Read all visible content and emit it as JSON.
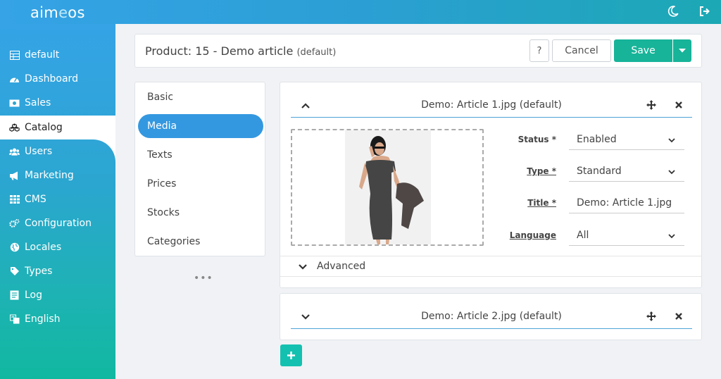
{
  "app": {
    "logo_left": "aim",
    "logo_o": "e",
    "logo_right": "os"
  },
  "sidebar": {
    "items": [
      {
        "label": "default",
        "icon": "table-icon"
      },
      {
        "label": "Dashboard",
        "icon": "dashboard-icon"
      },
      {
        "label": "Sales",
        "icon": "money-icon"
      },
      {
        "label": "Catalog",
        "icon": "cubes-icon",
        "active": true
      },
      {
        "label": "Users",
        "icon": "users-icon"
      },
      {
        "label": "Marketing",
        "icon": "bullhorn-icon"
      },
      {
        "label": "CMS",
        "icon": "grid-icon"
      },
      {
        "label": "Configuration",
        "icon": "cogs-icon"
      },
      {
        "label": "Locales",
        "icon": "globe-icon"
      },
      {
        "label": "Types",
        "icon": "tag-icon"
      },
      {
        "label": "Log",
        "icon": "file-icon"
      },
      {
        "label": "English",
        "icon": "language-icon"
      }
    ]
  },
  "header": {
    "title": "Product: 15 - Demo article",
    "title_suffix": "(default)",
    "help_label": "?",
    "cancel_label": "Cancel",
    "save_label": "Save"
  },
  "tabs": {
    "items": [
      {
        "label": "Basic"
      },
      {
        "label": "Media",
        "active": true
      },
      {
        "label": "Texts"
      },
      {
        "label": "Prices"
      },
      {
        "label": "Stocks"
      },
      {
        "label": "Categories"
      }
    ],
    "more": "•••"
  },
  "media": [
    {
      "title": "Demo: Article 1.jpg (default)",
      "expanded": true,
      "fields": {
        "status_label": "Status *",
        "status_value": "Enabled",
        "type_label": "Type *",
        "type_value": "Standard",
        "title_label": "Title *",
        "title_value": "Demo: Article 1.jpg",
        "language_label": "Language",
        "language_value": "All"
      },
      "advanced_label": "Advanced"
    },
    {
      "title": "Demo: Article 2.jpg (default)",
      "expanded": false
    }
  ],
  "colors": {
    "accent": "#17b499",
    "tab_active": "#3498e0",
    "add_button": "#14c1b0"
  }
}
